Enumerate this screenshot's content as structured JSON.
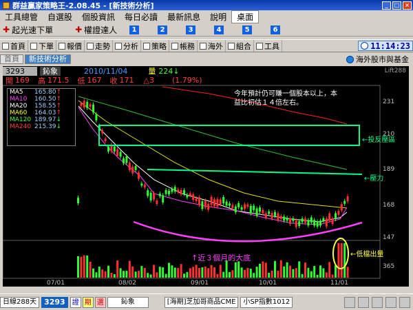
{
  "window": {
    "title": "群益贏家策略王-2.08.45 - [新技術分析]"
  },
  "menu": {
    "items": [
      "工具總管",
      "自選股",
      "個股資訊",
      "每日必讀",
      "最新訊息",
      "說明",
      "桌面"
    ]
  },
  "quick": {
    "left": "起光速下單",
    "right": "權證達人",
    "tabs": [
      "1",
      "2",
      "3",
      "4",
      "5",
      "6"
    ]
  },
  "toolbar": {
    "items": [
      "首頁",
      "下單",
      "報價",
      "走勢",
      "分析",
      "策略",
      "帳務",
      "海外",
      "組合",
      "工具"
    ],
    "clock": "11:14:23"
  },
  "tabs": {
    "items": [
      "首頁",
      "新技術分析"
    ],
    "overseas": "海外股市與基金"
  },
  "info": {
    "code": "3293",
    "name": "鈊象",
    "date": "2010/11/04",
    "volume_label": "量",
    "volume": "224",
    "volume_arrow": "↓",
    "right_code": "Lift288",
    "open_label": "開",
    "open": "169",
    "high_label": "高",
    "high": "171.5",
    "low_label": "低",
    "low": "167",
    "close_label": "收",
    "close": "171",
    "change": "△3",
    "change_pct": "(1.79%)"
  },
  "legend": [
    {
      "name": "MA5",
      "value": "165.80",
      "arrow": "↑",
      "color": "#ffffff"
    },
    {
      "name": "MA10",
      "value": "160.50",
      "arrow": "↑",
      "color": "#ff40ff"
    },
    {
      "name": "MA20",
      "value": "158.55",
      "arrow": "↑",
      "color": "#ffffff"
    },
    {
      "name": "MA60",
      "value": "164.03",
      "arrow": "↑",
      "color": "#ffff00"
    },
    {
      "name": "MA120",
      "value": "189.97",
      "arrow": "↓",
      "color": "#40ff40"
    },
    {
      "name": "MA240",
      "value": "215.39",
      "arrow": "↓",
      "color": "#ff4040"
    }
  ],
  "annotations": {
    "top_text_1": "今年預計仍可賺一個股本以上，本",
    "top_text_2": "益比初估１４倍左右。",
    "resistance_zone": "←投反壓區",
    "pressure": "←壓力",
    "volume_shrink": "←低檔出量",
    "base": "↑近３個月的大底"
  },
  "axis": {
    "price_ticks": [
      "231",
      "210",
      "189",
      "168",
      "147",
      "365"
    ],
    "date_ticks": [
      "07/01",
      "08/02",
      "09/01",
      "10/01",
      "11/01"
    ]
  },
  "bottom": {
    "period": "日線288天",
    "code": "3293",
    "buttons": [
      "證",
      "期",
      "選"
    ],
    "name": "鈊象",
    "quote1": "[海期]芝加哥商品CME",
    "quote2": "小SP指數1012"
  },
  "colors": {
    "up": "#ff3030",
    "down": "#30ff30",
    "accent": "#00ffaa"
  }
}
